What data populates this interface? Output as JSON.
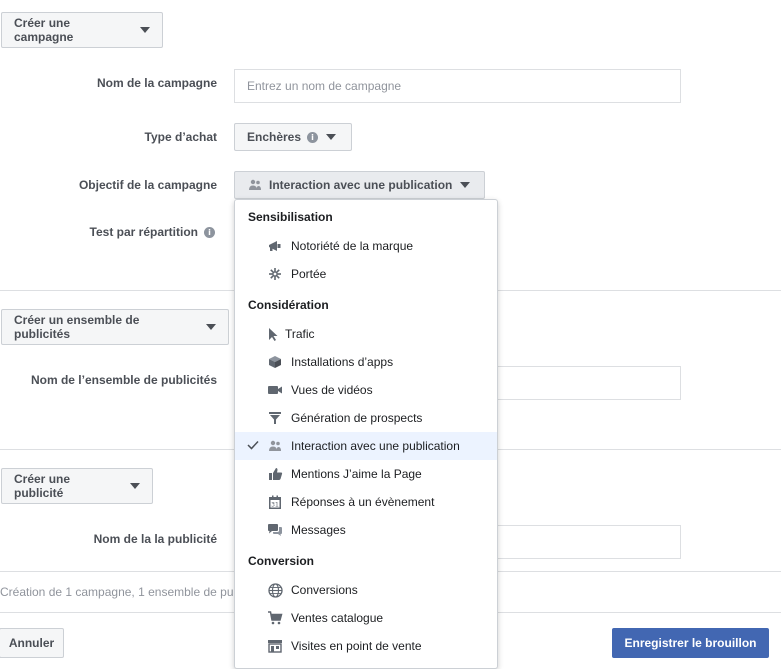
{
  "campaign": {
    "header_button": "Créer une campagne",
    "name_label": "Nom de la campagne",
    "name_placeholder": "Entrez un nom de campagne",
    "buy_type_label": "Type d’achat",
    "buy_type_value": "Enchères",
    "objective_label": "Objectif de la campagne",
    "objective_value": "Interaction avec une publication",
    "split_test_label": "Test par répartition"
  },
  "adset": {
    "header_button": "Créer un ensemble de publicités",
    "name_label": "Nom de l’ensemble de publicités"
  },
  "ad": {
    "header_button": "Créer une publicité",
    "name_label": "Nom de la la publicité"
  },
  "footer": {
    "summary": "Création de 1 campagne, 1 ensemble de pu",
    "cancel": "Annuler",
    "save_draft": "Enregistrer le brouillon"
  },
  "objective_menu": {
    "groups": [
      {
        "header": "Sensibilisation",
        "items": [
          {
            "label": "Notoriété de la marque",
            "icon": "megaphone-icon"
          },
          {
            "label": "Portée",
            "icon": "reach-icon"
          }
        ]
      },
      {
        "header": "Considération",
        "items": [
          {
            "label": "Trafic",
            "icon": "cursor-icon"
          },
          {
            "label": "Installations d’apps",
            "icon": "box-icon"
          },
          {
            "label": "Vues de vidéos",
            "icon": "video-camera-icon"
          },
          {
            "label": "Génération de prospects",
            "icon": "funnel-icon"
          },
          {
            "label": "Interaction avec une publication",
            "icon": "people-icon",
            "selected": true
          },
          {
            "label": "Mentions J’aime la Page",
            "icon": "thumbs-up-icon"
          },
          {
            "label": "Réponses à un évènement",
            "icon": "calendar-icon"
          },
          {
            "label": "Messages",
            "icon": "chat-icon"
          }
        ]
      },
      {
        "header": "Conversion",
        "items": [
          {
            "label": "Conversions",
            "icon": "globe-icon"
          },
          {
            "label": "Ventes catalogue",
            "icon": "cart-icon"
          },
          {
            "label": "Visites en point de vente",
            "icon": "store-icon"
          }
        ]
      }
    ]
  },
  "colors": {
    "primary": "#4267b2",
    "selected_bg": "#ecf3ff",
    "border": "#ccd0d5"
  }
}
